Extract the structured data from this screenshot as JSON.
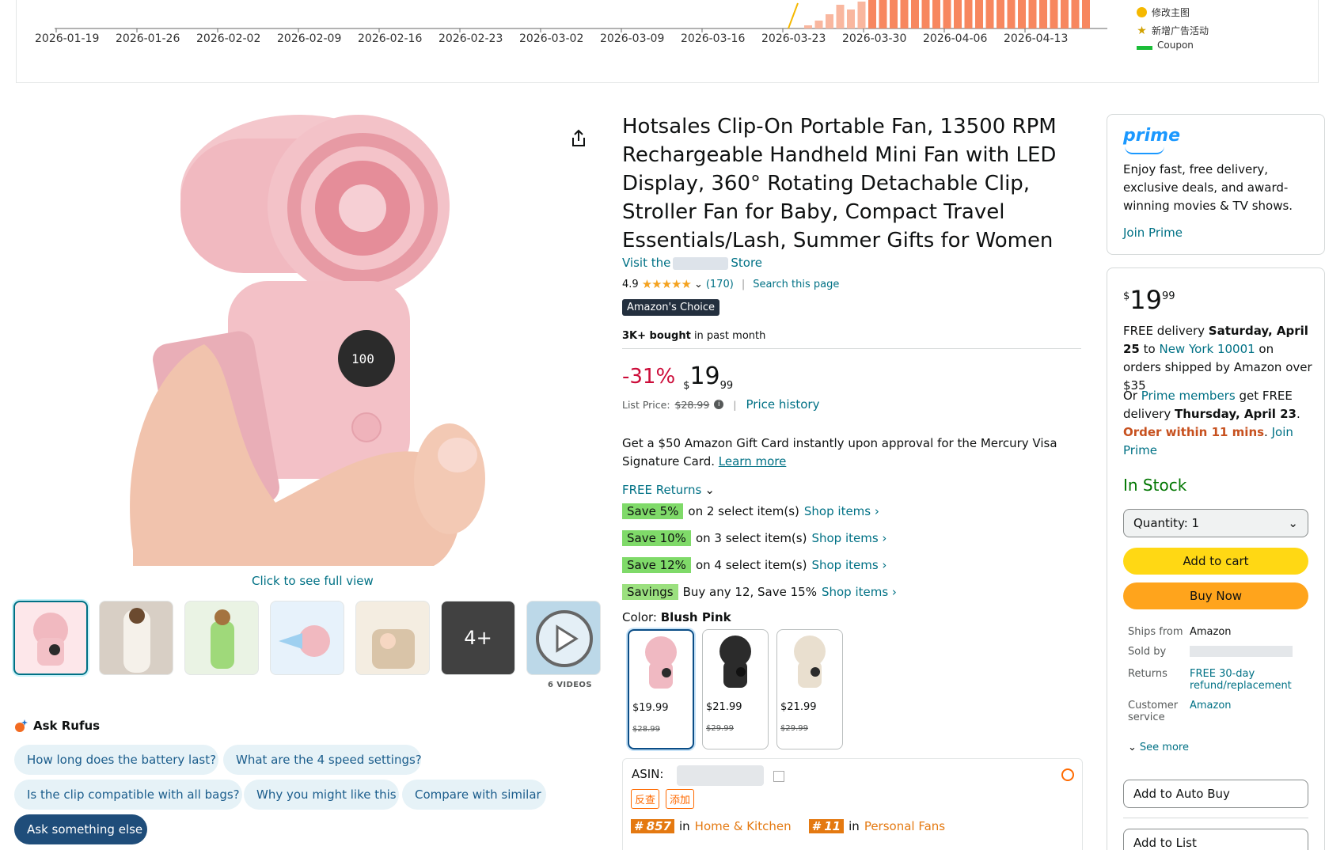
{
  "chart_strip": {
    "x_labels": [
      "2026-01-19",
      "2026-01-26",
      "2026-02-02",
      "2026-02-09",
      "2026-02-16",
      "2026-02-23",
      "2026-03-02",
      "2026-03-09",
      "2026-03-16",
      "2026-03-23",
      "2026-03-30",
      "2026-04-06",
      "2026-04-13"
    ],
    "legend": [
      {
        "label": "修改主图",
        "marker": "dot",
        "color": "#f5b800"
      },
      {
        "label": "新增广告活动",
        "marker": "star",
        "color": "#d1a100"
      },
      {
        "label": "Coupon",
        "marker": "bar",
        "color": "#1bbd38"
      }
    ],
    "bar_color": "#f7875f",
    "bar_color_light": "#f9b79f"
  },
  "product": {
    "title": "Hotsales Clip-On Portable Fan, 13500 RPM Rechargeable Handheld Mini Fan with LED Display, 360° Rotating Detachable Clip, Stroller Fan for Baby, Compact Travel Essentials/Lash, Summer Gifts for Women",
    "visit_prefix": "Visit the",
    "visit_suffix": "Store",
    "rating": "4.9",
    "stars": "★★★★★",
    "reviews": "(170)",
    "search_page": "Search this page",
    "badge": "Amazon's Choice",
    "bought_bold": "3K+ bought",
    "bought_rest": " in past month",
    "discount": "-31%",
    "price_symbol": "$",
    "price_whole": "19",
    "price_fraction": "99",
    "list_price_label": "List Price:",
    "list_price": "$28.99",
    "price_history": "Price history",
    "giftcard_text": "Get a $50 Amazon Gift Card instantly upon approval for the Mercury Visa Signature Card.",
    "learn_more": "Learn more",
    "free_returns": "FREE Returns",
    "promos": [
      {
        "tag": "Save 5%",
        "text": "on 2 select item(s)",
        "link": "Shop items ›"
      },
      {
        "tag": "Save 10%",
        "text": "on 3 select item(s)",
        "link": "Shop items ›"
      },
      {
        "tag": "Save 12%",
        "text": "on 4 select item(s)",
        "link": "Shop items ›"
      },
      {
        "tag": "Savings",
        "text": "Buy any 12, Save 15%",
        "link": "Shop items ›"
      }
    ],
    "color_label": "Color:",
    "color_value": "Blush Pink",
    "swatches": [
      {
        "price": "$19.99",
        "list": "$28.99",
        "body": "#f0b9c2"
      },
      {
        "price": "$21.99",
        "list": "$29.99",
        "body": "#2b2b2b"
      },
      {
        "price": "$21.99",
        "list": "$29.99",
        "body": "#e9dfcf"
      }
    ],
    "asin_label": "ASIN:",
    "tag1": "反查",
    "tag2": "添加",
    "rank1_num": "# 857",
    "rank1_in": "in",
    "rank1_cat": "Home & Kitchen",
    "rank2_num": "# 11",
    "rank2_in": "in",
    "rank2_cat": "Personal Fans"
  },
  "gallery": {
    "click_full": "Click to see full view",
    "more_count": "4+",
    "videos": "6 VIDEOS"
  },
  "rufus": {
    "title": "Ask Rufus",
    "questions": [
      "How long does the battery last?",
      "What are the 4 speed settings?",
      "Is the clip compatible with all bags?",
      "Why you might like this",
      "Compare with similar"
    ],
    "ask_else": "Ask something else"
  },
  "prime": {
    "logo": "prime",
    "desc": "Enjoy fast, free delivery, exclusive deals, and award-winning movies & TV shows.",
    "join": "Join Prime"
  },
  "buybox": {
    "price_symbol": "$",
    "price_whole": "19",
    "price_fraction": "99",
    "delivery_pre": "FREE delivery ",
    "delivery_date": "Saturday, April 25",
    "delivery_to": " to ",
    "delivery_loc": "New York 10001",
    "delivery_post": " on orders shipped by Amazon over $35",
    "or_pre": "Or ",
    "or_link": "Prime members",
    "or_mid": " get FREE delivery ",
    "or_date": "Thursday, April 23",
    "or_dot": ". ",
    "order_within": "Order within 11 mins",
    "or_join": "Join Prime",
    "in_stock": "In Stock",
    "quantity": "Quantity: 1",
    "add_to_cart": "Add to cart",
    "buy_now": "Buy Now",
    "ships_from_k": "Ships from",
    "ships_from_v": "Amazon",
    "sold_by_k": "Sold by",
    "returns_k": "Returns",
    "returns_v": "FREE 30-day refund/replacement",
    "service_k": "Customer service",
    "service_v": "Amazon",
    "see_more": "See more",
    "auto_buy": "Add to Auto Buy",
    "add_list": "Add to List"
  }
}
